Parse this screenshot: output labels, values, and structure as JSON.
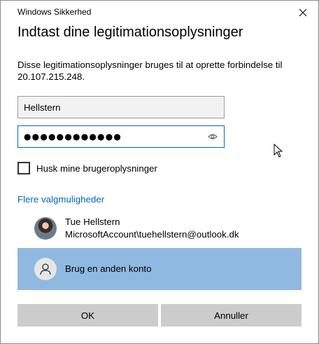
{
  "window": {
    "title": "Windows Sikkerhed"
  },
  "dialog": {
    "heading": "Indtast dine legitimationsoplysninger",
    "description": "Disse legitimationsoplysninger bruges til at oprette forbindelse til 20.107.215.248."
  },
  "form": {
    "username_value": "Hellstern",
    "password_mask": "●●●●●●●●●●●●",
    "remember_label": "Husk mine brugeroplysninger",
    "remember_checked": false
  },
  "more_options_label": "Flere valgmuligheder",
  "accounts": [
    {
      "name": "Tue Hellstern",
      "detail": "MicrosoftAccount\\tuehellstern@outlook.dk"
    },
    {
      "name": "Brug en anden konto",
      "selected": true
    }
  ],
  "buttons": {
    "ok": "OK",
    "cancel": "Annuller"
  },
  "icons": {
    "close": "close-icon",
    "reveal": "eye-icon",
    "generic_user": "user-icon"
  },
  "colors": {
    "accent": "#0067c0",
    "link": "#0067b8",
    "selected_bg": "#8fb9e1",
    "button_bg": "#cccccc"
  }
}
